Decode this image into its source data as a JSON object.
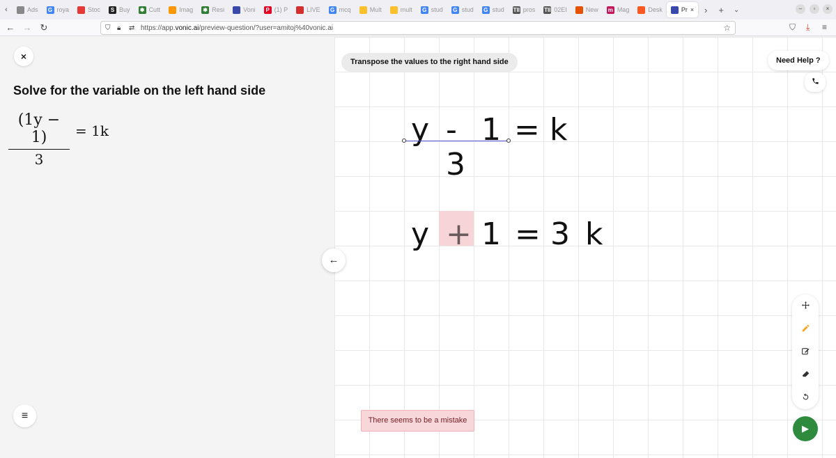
{
  "browser": {
    "tabs": [
      {
        "label": "Ads",
        "fav": "",
        "color": "#888888"
      },
      {
        "label": "roya",
        "fav": "G",
        "color": "#4285f4"
      },
      {
        "label": "Stoc",
        "fav": "",
        "color": "#e53935"
      },
      {
        "label": "Buy",
        "fav": "S",
        "color": "#222222"
      },
      {
        "label": "Cutt",
        "fav": "✱",
        "color": "#2e7d32"
      },
      {
        "label": "Imag",
        "fav": "",
        "color": "#ff9800"
      },
      {
        "label": "Resi",
        "fav": "✱",
        "color": "#2e7d32"
      },
      {
        "label": "Voni",
        "fav": "",
        "color": "#3949ab"
      },
      {
        "label": "(1) P",
        "fav": "P",
        "color": "#e60023"
      },
      {
        "label": "LIVE",
        "fav": "",
        "color": "#d32f2f"
      },
      {
        "label": "mcq",
        "fav": "G",
        "color": "#4285f4"
      },
      {
        "label": "Mult",
        "fav": "",
        "color": "#fbc02d"
      },
      {
        "label": "mult",
        "fav": "",
        "color": "#fbc02d"
      },
      {
        "label": "stud",
        "fav": "G",
        "color": "#4285f4"
      },
      {
        "label": "stud",
        "fav": "G",
        "color": "#4285f4"
      },
      {
        "label": "stud",
        "fav": "G",
        "color": "#4285f4"
      },
      {
        "label": "pros",
        "fav": "TII",
        "color": "#555555"
      },
      {
        "label": "02EI",
        "fav": "TII",
        "color": "#555555"
      },
      {
        "label": "New",
        "fav": "",
        "color": "#e65100"
      },
      {
        "label": "Mag",
        "fav": "m",
        "color": "#c2185b"
      },
      {
        "label": "Desk",
        "fav": "",
        "color": "#ff5722"
      },
      {
        "label": "Pr",
        "fav": "",
        "color": "#3949ab",
        "active": true
      }
    ],
    "url_prefix": "https://app.",
    "url_host": "vonic.ai",
    "url_path": "/preview-question/?user=amitoj%40vonic.ai"
  },
  "question": {
    "title": "Solve for the variable on the left hand side",
    "numerator": "(1y − 1)",
    "denominator": "3",
    "rhs": "= 1k"
  },
  "canvas": {
    "instruction": "Transpose the values to the right hand side",
    "help_label": "Need Help ?",
    "line1": {
      "y": "y",
      "minus": "-",
      "one": "1",
      "eq": "=",
      "k": "k",
      "den": "3"
    },
    "line2": {
      "y": "y",
      "plus": "+",
      "one": "1",
      "eq": "=",
      "three": "3",
      "k": "k"
    },
    "mistake_message": "There seems to be a mistake"
  },
  "icons": {
    "close": "×",
    "menu": "≡",
    "back": "←",
    "phone": "phone",
    "move": "move",
    "pen": "pencil",
    "edit": "edit",
    "eraser": "eraser",
    "undo": "undo",
    "run": "play"
  }
}
